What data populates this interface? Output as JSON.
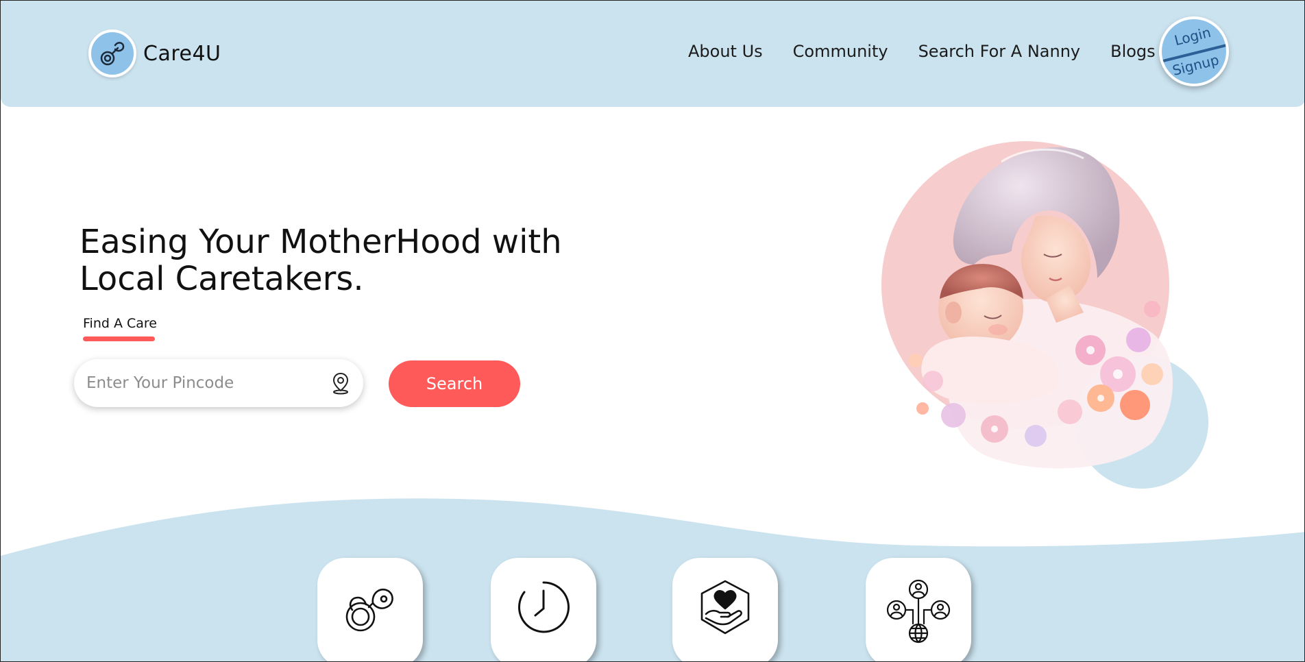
{
  "brand": {
    "name": "Care4U",
    "logo_icon": "pacifier-icon"
  },
  "nav": {
    "items": [
      {
        "label": "About Us"
      },
      {
        "label": "Community"
      },
      {
        "label": "Search For A Nanny"
      },
      {
        "label": "Blogs"
      }
    ]
  },
  "auth": {
    "login_label": "Login",
    "signup_label": "Signup"
  },
  "hero": {
    "headline_line1": "Easing Your MotherHood with",
    "headline_line2": "Local Caretakers.",
    "find_care_label": "Find A Care",
    "pincode_placeholder": "Enter Your Pincode",
    "pincode_value": "",
    "search_label": "Search"
  },
  "features": [
    {
      "icon": "pacifier-icon"
    },
    {
      "icon": "clock-icon"
    },
    {
      "icon": "heart-in-hand-icon"
    },
    {
      "icon": "network-people-icon"
    }
  ],
  "colors": {
    "header_bg": "#cbe3ef",
    "accent": "#ff5a5a",
    "logo_bg": "#8ec2e8",
    "wave_bg": "#cbe3ef"
  }
}
